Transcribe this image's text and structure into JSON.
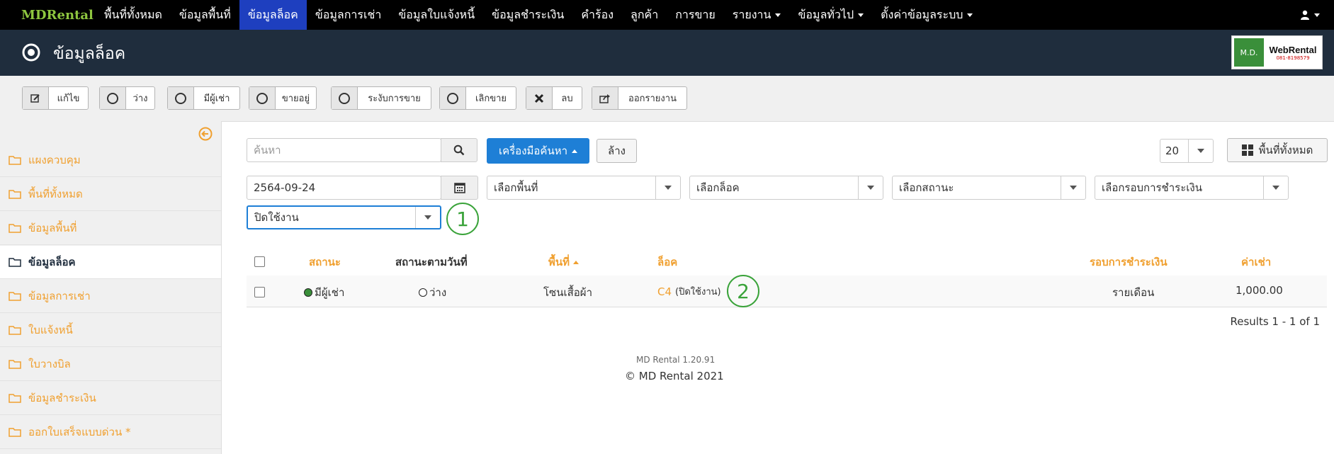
{
  "navbar": {
    "brand": "MDRental",
    "items": [
      {
        "label": "พื้นที่ทั้งหมด"
      },
      {
        "label": "ข้อมูลพื้นที่"
      },
      {
        "label": "ข้อมูลล็อค"
      },
      {
        "label": "ข้อมูลการเช่า"
      },
      {
        "label": "ข้อมูลใบแจ้งหนี้"
      },
      {
        "label": "ข้อมูลชำระเงิน"
      },
      {
        "label": "คำร้อง"
      },
      {
        "label": "ลูกค้า"
      },
      {
        "label": "การขาย"
      },
      {
        "label": "รายงาน"
      },
      {
        "label": "ข้อมูลทั่วไป"
      },
      {
        "label": "ตั้งค่าข้อมูลระบบ"
      }
    ],
    "active_index": 2
  },
  "header": {
    "title": "ข้อมูลล็อค",
    "logo": {
      "md": "M.D.",
      "text": "WebRental",
      "phone": "081-8198579"
    }
  },
  "toolbar": {
    "edit": "แก้ไข",
    "vacant": "ว่าง",
    "occupied": "มีผู้เช่า",
    "selling": "ขายอยู่",
    "suspend_sale": "ระงับการขาย",
    "stop_sale": "เลิกขาย",
    "delete": "ลบ",
    "export": "ออกรายงาน"
  },
  "sidebar": {
    "items": [
      {
        "label": "แผงควบคุม"
      },
      {
        "label": "พื้นที่ทั้งหมด"
      },
      {
        "label": "ข้อมูลพื้นที่"
      },
      {
        "label": "ข้อมูลล็อค"
      },
      {
        "label": "ข้อมูลการเช่า"
      },
      {
        "label": "ใบแจ้งหนี้"
      },
      {
        "label": "ใบวางบิล"
      },
      {
        "label": "ข้อมูลชำระเงิน"
      },
      {
        "label": "ออกใบเสร็จแบบด่วน *"
      }
    ],
    "active_index": 3
  },
  "filters": {
    "search_placeholder": "ค้นหา",
    "search_tools": "เครื่องมือค้นหา",
    "clear": "ล้าง",
    "page_size": "20",
    "all_areas_button": "พื้นที่ทั้งหมด",
    "date": "2564-09-24",
    "area_placeholder": "เลือกพื้นที่",
    "lock_placeholder": "เลือกล็อค",
    "status_placeholder": "เลือกสถานะ",
    "payment_cycle_placeholder": "เลือกรอบการชำระเงิน",
    "active_filter": "ปิดใช้งาน"
  },
  "callouts": {
    "first": "1",
    "second": "2"
  },
  "table": {
    "columns": {
      "status": "สถานะ",
      "status_by_date": "สถานะตามวันที่",
      "area": "พื้นที่",
      "lock": "ล็อค",
      "payment_cycle": "รอบการชำระเงิน",
      "rent": "ค่าเช่า"
    },
    "rows": [
      {
        "status": "มีผู้เช่า",
        "status_by_date": "ว่าง",
        "area": "โซนเสื้อผ้า",
        "lock": "C4",
        "lock_note": "(ปิดใช้งาน)",
        "payment_cycle": "รายเดือน",
        "rent": "1,000.00"
      }
    ],
    "results": "Results 1 - 1 of 1"
  },
  "footer": {
    "version": "MD Rental 1.20.91",
    "copyright": "© MD Rental 2021"
  },
  "colors": {
    "navbar_bg": "#000000",
    "nav_active": "#1e3fbf",
    "header_bg": "#1f2d3d",
    "accent_orange": "#f0a030",
    "primary_blue": "#1e7fd6",
    "callout_green": "#3aa33a"
  }
}
